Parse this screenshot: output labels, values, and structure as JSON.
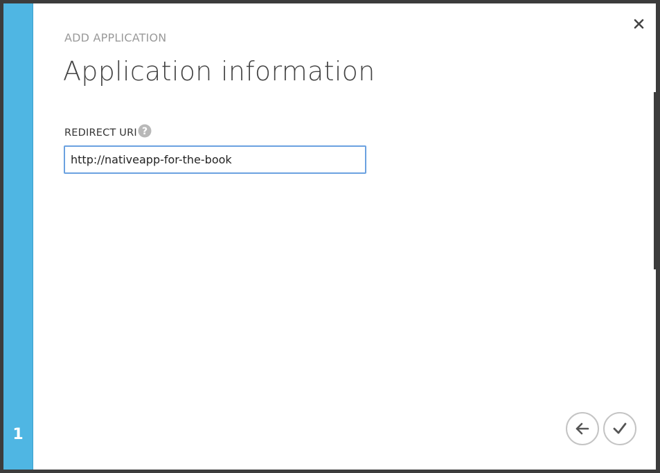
{
  "dialog": {
    "subtitle": "ADD APPLICATION",
    "title": "Application information",
    "step_number": "1",
    "accent_color": "#4fb6e3"
  },
  "form": {
    "redirect_uri_label": "REDIRECT URI",
    "redirect_uri_value": "http://nativeapp-for-the-book",
    "help_icon": "question-icon"
  },
  "actions": {
    "close_icon": "close-icon",
    "back_icon": "arrow-left-icon",
    "finish_icon": "checkmark-icon"
  }
}
